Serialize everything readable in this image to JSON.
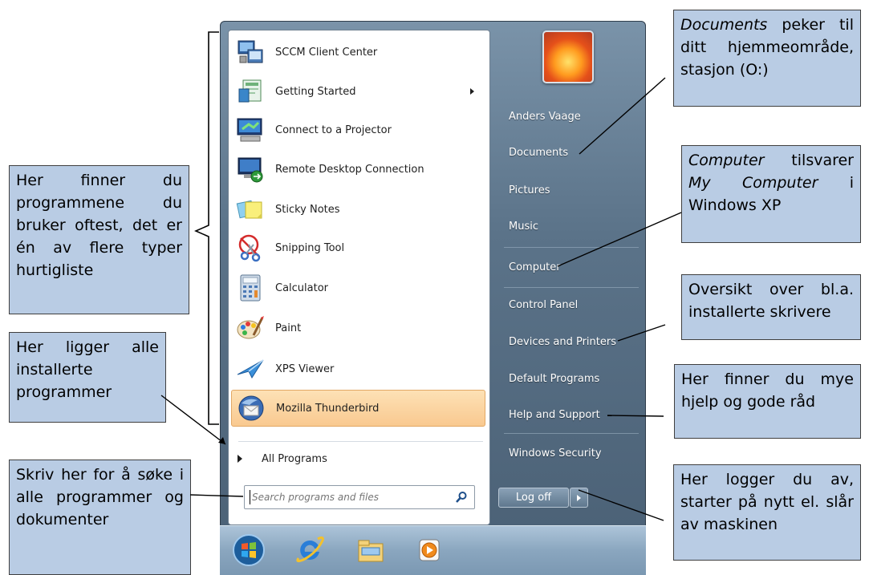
{
  "start_menu": {
    "programs": [
      {
        "label": "SCCM Client Center",
        "icon": "sccm-icon"
      },
      {
        "label": "Getting Started",
        "icon": "getting-started-icon",
        "has_submenu": true
      },
      {
        "label": "Connect to a Projector",
        "icon": "projector-icon"
      },
      {
        "label": "Remote Desktop Connection",
        "icon": "remote-desktop-icon"
      },
      {
        "label": "Sticky Notes",
        "icon": "sticky-notes-icon"
      },
      {
        "label": "Snipping Tool",
        "icon": "snipping-tool-icon"
      },
      {
        "label": "Calculator",
        "icon": "calculator-icon"
      },
      {
        "label": "Paint",
        "icon": "paint-icon"
      },
      {
        "label": "XPS Viewer",
        "icon": "xps-viewer-icon"
      },
      {
        "label": "Mozilla Thunderbird",
        "icon": "thunderbird-icon",
        "highlighted": true
      }
    ],
    "all_programs": "All Programs",
    "search_placeholder": "Search programs and files",
    "right_items": [
      "Anders Vaage",
      "Documents",
      "Pictures",
      "Music",
      "Computer",
      "Control Panel",
      "Devices and Printers",
      "Default Programs",
      "Help and Support",
      "Windows Security"
    ],
    "log_off": "Log off"
  },
  "taskbar": {
    "icons": [
      "start-orb-icon",
      "internet-explorer-icon",
      "windows-explorer-icon",
      "media-player-icon"
    ]
  },
  "callouts": {
    "documents_em": "Documents",
    "documents_rest": " peker til ditt hjemmeområ­de, stasjon (O:)",
    "computer_em": "Computer",
    "computer_mid": " tilsvarer ",
    "computer_em2": "My Computer",
    "computer_rest": " i Windows XP",
    "printers": "Oversikt over bl.a. installerte skrivere",
    "help": "Her finner du mye hjelp og gode råd",
    "logoff": "Her logger du av, starter på nytt el. slår av maskinen",
    "frequent": "Her finner du programmene du bruker oftest, det er én av flere typer hurtigliste",
    "all_programs": "Her ligger alle installerte programmer",
    "search": "Skriv her for å søke i alle pro­grammer og dokumenter"
  },
  "colors": {
    "callout_bg": "#b9cce4",
    "menu_right": "#5b7389",
    "highlight": "#f9c990"
  }
}
